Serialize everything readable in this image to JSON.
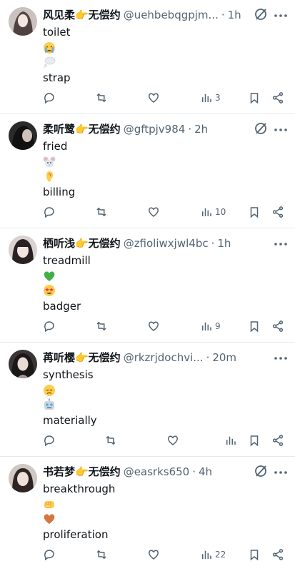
{
  "tweets": [
    {
      "display_name": "风见柔👉无偿约",
      "handle": "@uehbebqgpjm...",
      "time": "1h",
      "text_lines": [
        "toilet",
        "strap"
      ],
      "emojis": [
        "crying-face",
        "thought-balloon"
      ],
      "views": "3"
    },
    {
      "display_name": "柔听鹭👉无偿约",
      "handle": "@gftpjv984",
      "time": "2h",
      "text_lines": [
        "fried",
        "billing"
      ],
      "emojis": [
        "mouse-face",
        "ear"
      ],
      "views": "10"
    },
    {
      "display_name": "栖听浅👉无偿约",
      "handle": "@zfioliwxjwl4bc",
      "time": "1h",
      "text_lines": [
        "treadmill",
        "badger"
      ],
      "emojis": [
        "green-heart",
        "star-struck"
      ],
      "views": "9"
    },
    {
      "display_name": "苒听樱👉无偿约",
      "handle": "@rkzrjdochvi...",
      "time": "20m",
      "text_lines": [
        "synthesis",
        "materially"
      ],
      "emojis": [
        "disappointed-face",
        "robot"
      ],
      "views": ""
    },
    {
      "display_name": "书若梦👉无偿约",
      "handle": "@easrks650",
      "time": "4h",
      "text_lines": [
        "breakthrough",
        "proliferation"
      ],
      "emojis": [
        "oncoming-fist",
        "orange-heart"
      ],
      "views": "22"
    }
  ],
  "dot": "·"
}
